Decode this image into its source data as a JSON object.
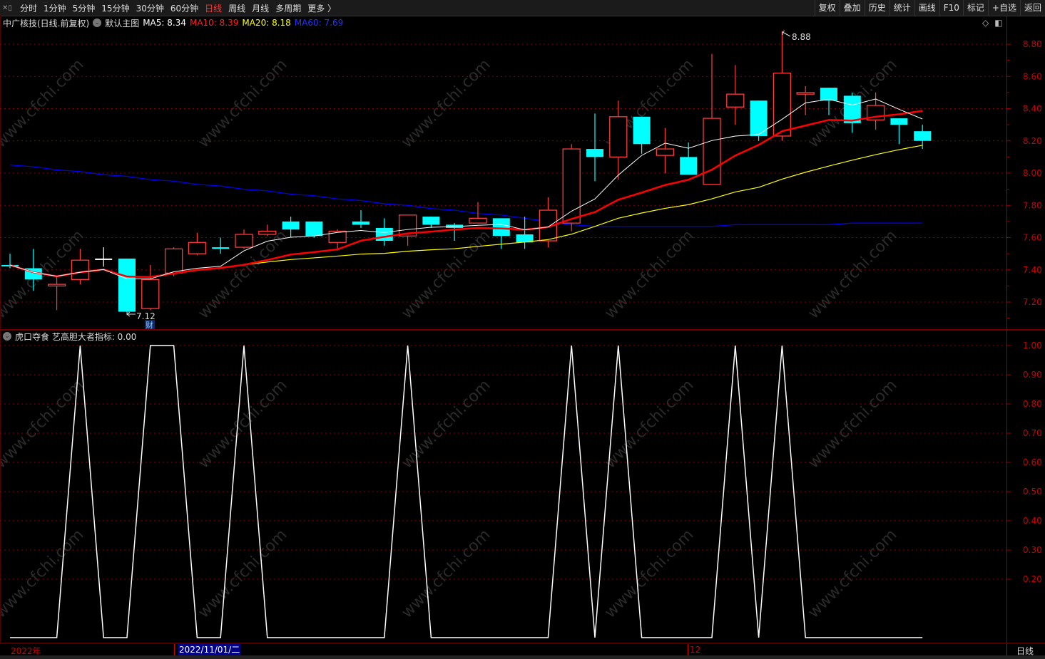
{
  "topbar": {
    "periods": [
      "分时",
      "1分钟",
      "5分钟",
      "15分钟",
      "30分钟",
      "60分钟",
      "日线",
      "周线",
      "月线",
      "多周期",
      "更多 〉"
    ],
    "active_period": "日线",
    "right_buttons": [
      "复权",
      "叠加",
      "历史",
      "统计",
      "画线",
      "F10",
      "标记",
      "+自选",
      "返回"
    ]
  },
  "main": {
    "title": "中广核技(日线.前复权)",
    "template": "默认主图",
    "ma5": "MA5: 8.34",
    "ma10": "MA10: 8.39",
    "ma20": "MA20: 8.18",
    "ma60": "MA60: 7.69",
    "high_label": "8.88",
    "low_label": "7.12",
    "finance_badge": "财",
    "axis_labels": [
      "8.80",
      "8.60",
      "8.40",
      "8.20",
      "8.00",
      "7.80",
      "7.60",
      "7.40",
      "7.20"
    ]
  },
  "indicator": {
    "title": "虎口夺食  艺高胆大者指标: 0.00",
    "axis_labels": [
      "1.00",
      "0.90",
      "0.80",
      "0.70",
      "0.60",
      "0.50",
      "0.40",
      "0.30",
      "0.20"
    ],
    "values": [
      0,
      0,
      0,
      1,
      0,
      0,
      1,
      1,
      0,
      0,
      1,
      0,
      0,
      0,
      0,
      0,
      0,
      1,
      0,
      0,
      0,
      0,
      0,
      0,
      1,
      0,
      1,
      0,
      0,
      0,
      0,
      1,
      0,
      1,
      0,
      0,
      0,
      0,
      0,
      0
    ]
  },
  "datebar": {
    "year": "2022年",
    "cursor_date": "2022/11/01/二",
    "month_mark": "12",
    "period": "日线"
  },
  "watermark": "www.cfchi.com",
  "colors": {
    "up": "#ff3b3b",
    "down": "#00ffff",
    "ma5": "#ffffff",
    "ma10": "#ff0000",
    "ma20": "#ffff00",
    "ma60": "#0000ff",
    "axis": "#cc0000"
  },
  "chart_data": {
    "type": "candlestick",
    "ohlc": [
      [
        7.43,
        7.5,
        7.41,
        7.43
      ],
      [
        7.41,
        7.53,
        7.27,
        7.34
      ],
      [
        7.3,
        7.36,
        7.15,
        7.31
      ],
      [
        7.34,
        7.53,
        7.31,
        7.46
      ],
      [
        7.47,
        7.54,
        7.42,
        7.47
      ],
      [
        7.47,
        7.47,
        7.12,
        7.14
      ],
      [
        7.16,
        7.43,
        7.15,
        7.34
      ],
      [
        7.38,
        7.54,
        7.36,
        7.53
      ],
      [
        7.5,
        7.63,
        7.49,
        7.57
      ],
      [
        7.54,
        7.6,
        7.5,
        7.53
      ],
      [
        7.54,
        7.65,
        7.53,
        7.62
      ],
      [
        7.62,
        7.68,
        7.61,
        7.64
      ],
      [
        7.7,
        7.73,
        7.6,
        7.65
      ],
      [
        7.7,
        7.7,
        7.6,
        7.61
      ],
      [
        7.57,
        7.65,
        7.53,
        7.64
      ],
      [
        7.7,
        7.77,
        7.66,
        7.68
      ],
      [
        7.66,
        7.72,
        7.55,
        7.58
      ],
      [
        7.61,
        7.74,
        7.55,
        7.74
      ],
      [
        7.73,
        7.73,
        7.66,
        7.68
      ],
      [
        7.68,
        7.69,
        7.58,
        7.66
      ],
      [
        7.69,
        7.82,
        7.69,
        7.72
      ],
      [
        7.72,
        7.72,
        7.53,
        7.61
      ],
      [
        7.62,
        7.73,
        7.53,
        7.57
      ],
      [
        7.58,
        7.85,
        7.54,
        7.77
      ],
      [
        7.69,
        8.18,
        7.64,
        8.15
      ],
      [
        8.15,
        8.37,
        7.95,
        8.1
      ],
      [
        8.1,
        8.45,
        7.96,
        8.35
      ],
      [
        8.35,
        8.35,
        8.12,
        8.18
      ],
      [
        8.11,
        8.28,
        8.0,
        8.15
      ],
      [
        8.1,
        8.19,
        7.99,
        7.99
      ],
      [
        7.93,
        8.74,
        7.93,
        8.34
      ],
      [
        8.41,
        8.67,
        8.3,
        8.49
      ],
      [
        8.45,
        8.45,
        8.2,
        8.23
      ],
      [
        8.23,
        8.88,
        8.2,
        8.62
      ],
      [
        8.49,
        8.54,
        8.36,
        8.5
      ],
      [
        8.53,
        8.53,
        8.36,
        8.45
      ],
      [
        8.48,
        8.5,
        8.25,
        8.31
      ],
      [
        8.33,
        8.5,
        8.27,
        8.42
      ],
      [
        8.34,
        8.34,
        8.18,
        8.3
      ],
      [
        8.26,
        8.3,
        8.15,
        8.2
      ]
    ],
    "ma60": [
      8.05,
      8.04,
      8.02,
      8.01,
      7.99,
      7.98,
      7.96,
      7.95,
      7.93,
      7.92,
      7.9,
      7.89,
      7.87,
      7.86,
      7.84,
      7.83,
      7.81,
      7.8,
      7.78,
      7.77,
      7.75,
      7.74,
      7.72,
      7.7,
      7.68,
      7.67,
      7.67,
      7.67,
      7.67,
      7.67,
      7.67,
      7.68,
      7.68,
      7.68,
      7.68,
      7.68,
      7.69,
      7.69,
      7.69,
      7.69
    ],
    "ylim": [
      7.12,
      8.92
    ],
    "indicator_ylim": [
      0,
      1
    ]
  }
}
